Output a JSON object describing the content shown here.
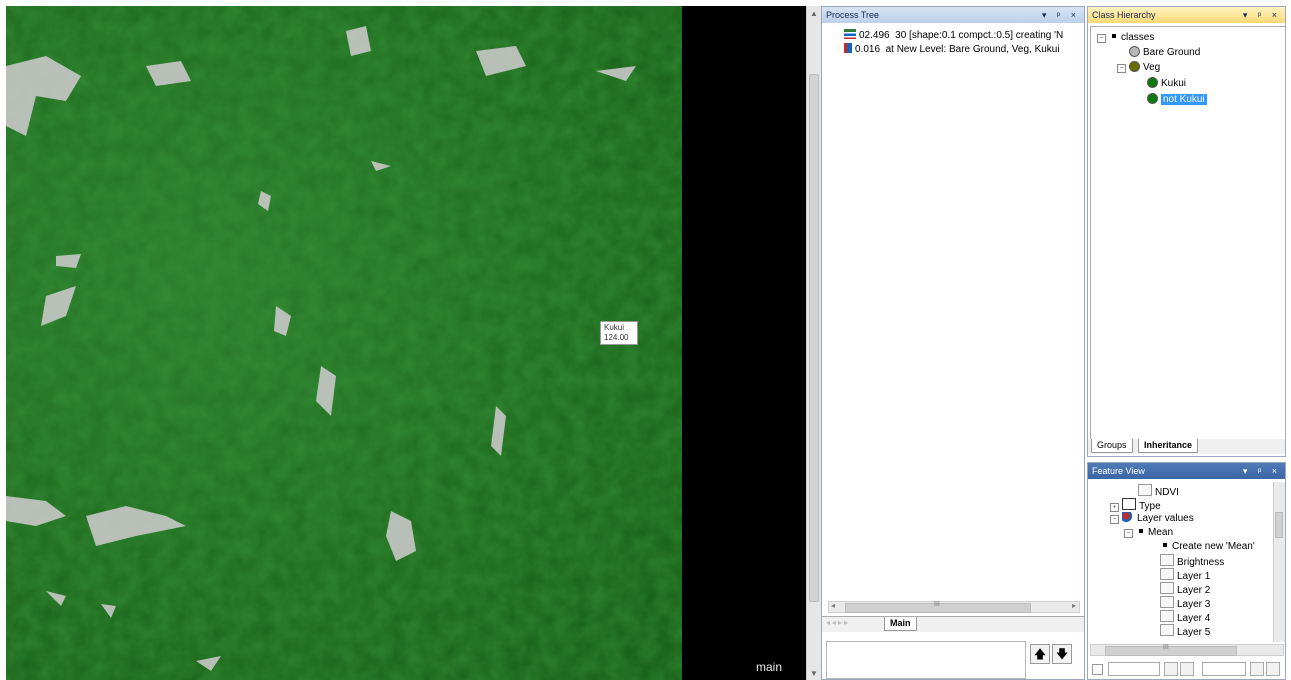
{
  "map": {
    "label": "main",
    "tooltip": {
      "class_name": "Kukui",
      "value": "124.00"
    }
  },
  "process_tree": {
    "title": "Process Tree",
    "controls": "▾ ᵖ ×",
    "rows": [
      {
        "time": "02.496",
        "text": "30 [shape:0.1 compct.:0.5] creating 'N"
      },
      {
        "time": "0.016",
        "text": "at  New Level: Bare Ground, Veg, Kukui"
      }
    ],
    "tab_main": "Main",
    "scroll_mark": "III"
  },
  "class_hierarchy": {
    "title": "Class Hierarchy",
    "controls": "▾ ᵖ ×",
    "root": "classes",
    "items": [
      {
        "label": "Bare Ground",
        "color": "#b8b8b8"
      },
      {
        "label": "Veg",
        "color": "#6b6b00"
      },
      {
        "label": "Kukui",
        "color": "#0a7a0a"
      },
      {
        "label": "not Kukui",
        "color": "#0a7a0a",
        "selected": true
      }
    ],
    "tabs": [
      "Groups",
      "Inheritance"
    ]
  },
  "feature_view": {
    "title": "Feature View",
    "controls": "▾ ᵖ ×",
    "items": [
      {
        "label": "NDVI"
      },
      {
        "label": "Type"
      },
      {
        "label": "Layer values"
      },
      {
        "label": "Mean"
      },
      {
        "label": "Create new 'Mean'"
      },
      {
        "label": "Brightness"
      },
      {
        "label": "Layer 1"
      },
      {
        "label": "Layer 2"
      },
      {
        "label": "Layer 3"
      },
      {
        "label": "Layer 4"
      },
      {
        "label": "Layer 5"
      }
    ],
    "scroll_mark": "III"
  },
  "colors": {
    "map_green": "#1f6b1f",
    "selection": "#3399ff",
    "titlebar": "#bcd0ea",
    "active_titlebar": "#f9d975"
  }
}
